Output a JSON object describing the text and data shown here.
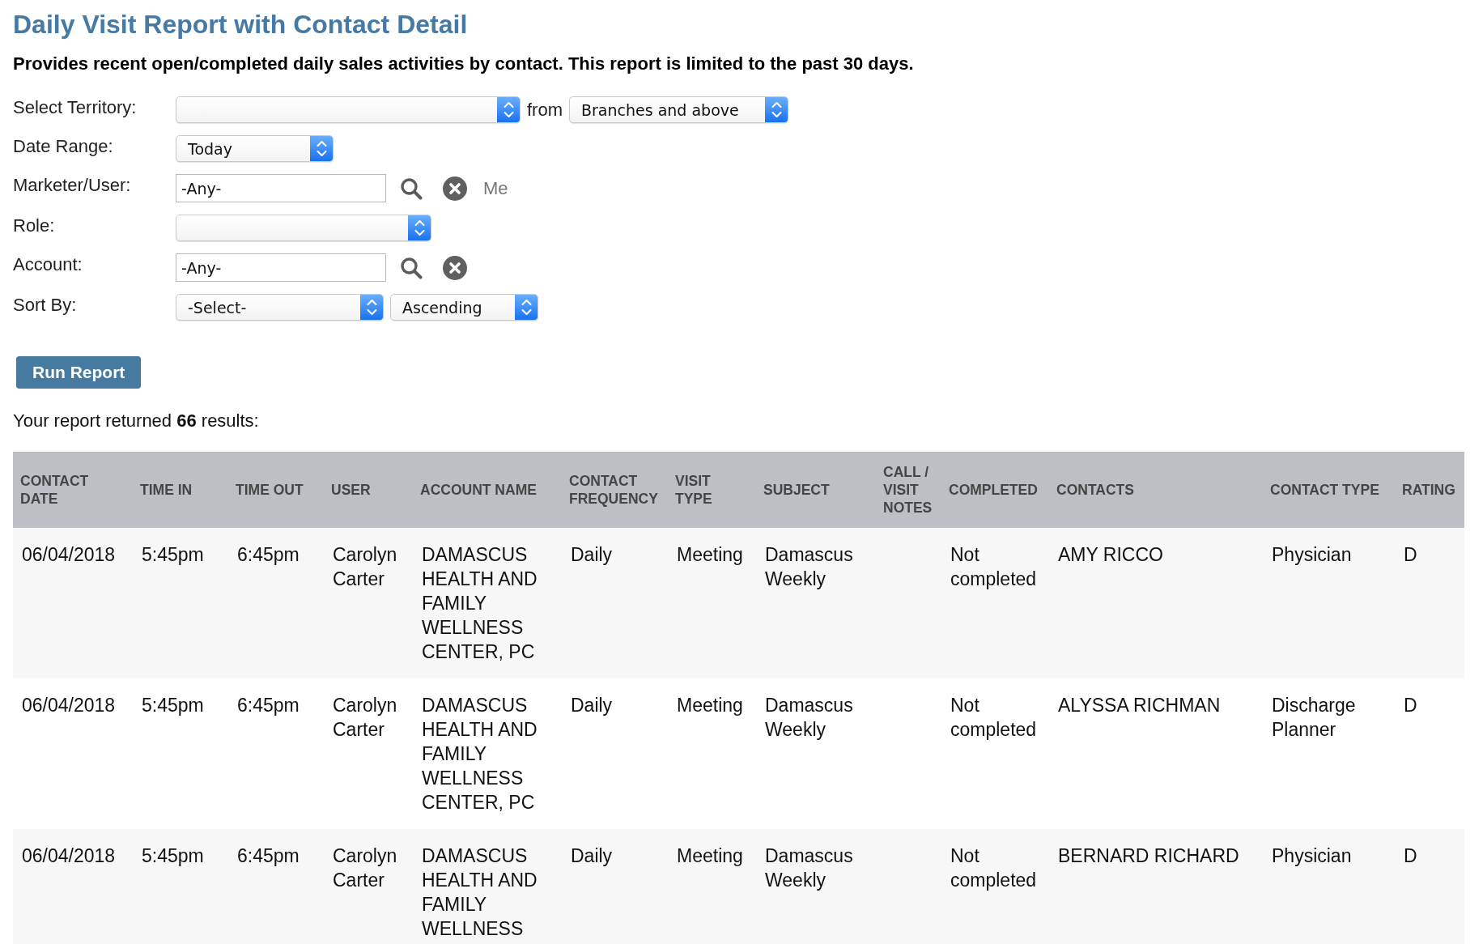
{
  "title": "Daily Visit Report with Contact Detail",
  "description": "Provides recent open/completed daily sales activities by contact. This report is limited to the past 30 days.",
  "filters": [
    {
      "label": "Select Territory:",
      "controls": [
        {
          "kind": "select"
        },
        {
          "kind": "text",
          "text": "from"
        },
        {
          "kind": "select",
          "value": "Branches and above"
        }
      ]
    },
    {
      "label": "Date Range:",
      "controls": [
        {
          "kind": "select",
          "value": "Today"
        }
      ]
    },
    {
      "label": "Marketer/User:",
      "controls": [
        {
          "kind": "input",
          "value": "-Any-"
        },
        {
          "kind": "search"
        },
        {
          "kind": "clear"
        },
        {
          "kind": "link",
          "text": "Me"
        }
      ]
    },
    {
      "label": "Role:",
      "controls": [
        {
          "kind": "select"
        }
      ]
    },
    {
      "label": "Account:",
      "controls": [
        {
          "kind": "input",
          "value": "-Any-"
        },
        {
          "kind": "search"
        },
        {
          "kind": "clear"
        }
      ]
    },
    {
      "label": "Sort By:",
      "controls": [
        {
          "kind": "select",
          "value": "-Select-"
        },
        {
          "kind": "select",
          "value": "Ascending"
        }
      ]
    }
  ],
  "run_button": "Run Report",
  "summary": "Your report returned **66** results:",
  "table": {
    "columns": [
      "CONTACT DATE",
      "TIME IN",
      "TIME OUT",
      "USER",
      "ACCOUNT NAME",
      "CONTACT FREQUENCY",
      "VISIT TYPE",
      "SUBJECT",
      "CALL / VISIT NOTES",
      "COMPLETED",
      "CONTACTS",
      "CONTACT TYPE",
      "RATING"
    ],
    "rows": [
      {
        "contact_date": "06/04/2018",
        "time_in": "5:45pm",
        "time_out": "6:45pm",
        "user": "Carolyn Carter",
        "account_name": "DAMASCUS HEALTH AND FAMILY WELLNESS CENTER, PC",
        "contact_frequency": "Daily",
        "visit_type": "Meeting",
        "subject": "Damascus Weekly",
        "completed": "Not completed",
        "contacts": "AMY RICCO",
        "contact_type": "Physician",
        "rating": "D"
      },
      {
        "contact_date": "06/04/2018",
        "time_in": "5:45pm",
        "time_out": "6:45pm",
        "user": "Carolyn Carter",
        "account_name": "DAMASCUS HEALTH AND FAMILY WELLNESS CENTER, PC",
        "contact_frequency": "Daily",
        "visit_type": "Meeting",
        "subject": "Damascus Weekly",
        "completed": "Not completed",
        "contacts": "ALYSSA RICHMAN",
        "contact_type": "Discharge Planner",
        "rating": "D"
      },
      {
        "contact_date": "06/04/2018",
        "time_in": "5:45pm",
        "time_out": "6:45pm",
        "user": "Carolyn Carter",
        "account_name": "DAMASCUS HEALTH AND FAMILY WELLNESS",
        "contact_frequency": "Daily",
        "visit_type": "Meeting",
        "subject": "Damascus Weekly",
        "completed": "Not completed",
        "contacts": "BERNARD RICHARD",
        "contact_type": "Physician",
        "rating": "D"
      }
    ]
  }
}
